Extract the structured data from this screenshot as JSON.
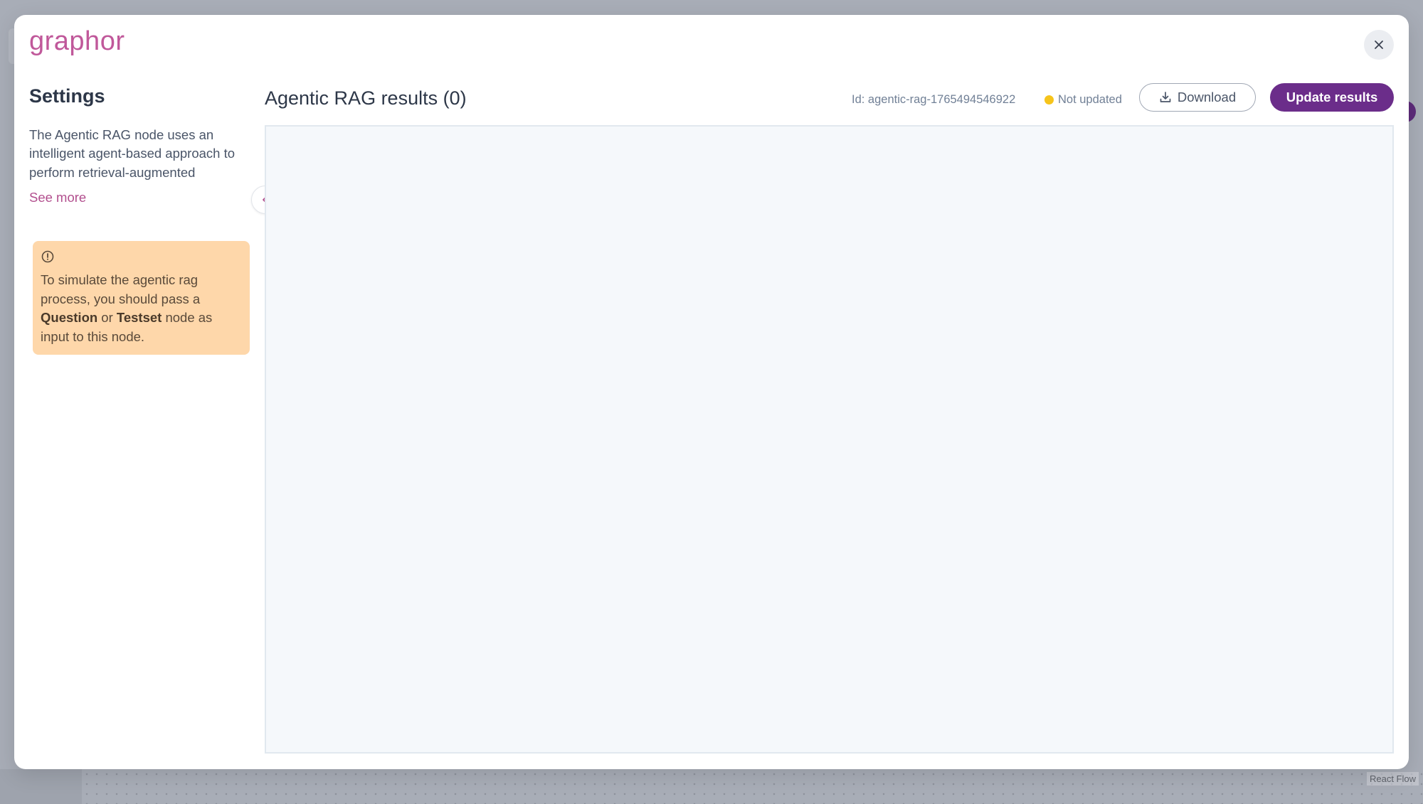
{
  "app": {
    "logo_text": "graphor"
  },
  "settings": {
    "title": "Settings",
    "description": "The Agentic RAG node uses an intelligent agent-based approach to perform retrieval-augmented",
    "see_more": "See more",
    "warning": {
      "icon": "alert-circle-icon",
      "text_part1": "To simulate the agentic rag process, you should pass a ",
      "bold1": "Question",
      "text_part2": " or ",
      "bold2": "Testset",
      "text_part3": " node as input to this node."
    }
  },
  "results": {
    "title": "Agentic RAG results (0)",
    "id_text": "Id: agentic-rag-1765494546922",
    "status_text": "Not updated",
    "download_label": "Download",
    "update_label": "Update results"
  },
  "canvas": {
    "attribution": "React Flow"
  },
  "colors": {
    "brand": "#c0589a",
    "primary_button": "#6b2d8a",
    "status_dot": "#f6c41b",
    "warning_bg": "#fed7aa",
    "link": "#b24f8e"
  }
}
